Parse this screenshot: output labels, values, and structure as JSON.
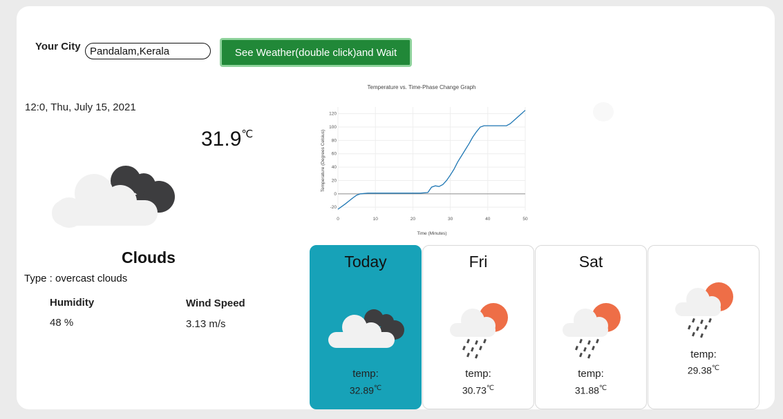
{
  "search": {
    "city_label": "Your City",
    "city_value": "Pandalam,Kerala",
    "button_label": "See Weather(double click)and Wait"
  },
  "current": {
    "datetime": "12:0, Thu, July 15, 2021",
    "temperature": "31.9",
    "unit": "℃",
    "condition": "Clouds",
    "type": "Type : overcast clouds",
    "humidity_label": "Humidity",
    "humidity_value": "48 %",
    "wind_label": "Wind Speed",
    "wind_value": "3.13 m/s",
    "icon": "broken-clouds-icon"
  },
  "chart_data": {
    "type": "line",
    "title": "Temperature vs. Time-Phase Change Graph",
    "xlabel": "Time (Minutes)",
    "ylabel": "Temperature (Degrees Celsius)",
    "xlim": [
      0,
      50
    ],
    "ylim": [
      -25,
      130
    ],
    "xticks": [
      0,
      10,
      20,
      30,
      40,
      50
    ],
    "yticks": [
      -20,
      0,
      20,
      40,
      60,
      80,
      100,
      120
    ],
    "series": [
      {
        "color": "#1f77b4",
        "x": [
          0,
          2,
          4,
          5,
          6,
          8,
          10,
          15,
          20,
          22,
          24,
          25,
          26,
          27,
          28,
          29,
          30,
          31,
          32,
          33,
          34,
          35,
          36,
          37,
          38,
          39,
          40,
          42,
          44,
          45,
          46,
          48,
          50
        ],
        "y": [
          -23,
          -15,
          -6,
          -2,
          0,
          1,
          1,
          1,
          1,
          1,
          2,
          10,
          12,
          11,
          14,
          20,
          28,
          37,
          48,
          57,
          66,
          75,
          85,
          93,
          100,
          102,
          102,
          102,
          102,
          102,
          105,
          115,
          125
        ]
      }
    ]
  },
  "forecast": [
    {
      "day": "Today",
      "temp_label": "temp:",
      "temp_value": "32.89",
      "unit": "℃",
      "icon": "broken-clouds-icon",
      "highlight": "#17a2b8"
    },
    {
      "day": "Fri",
      "temp_label": "temp:",
      "temp_value": "30.73",
      "unit": "℃",
      "icon": "rain-sun-icon"
    },
    {
      "day": "Sat",
      "temp_label": "temp:",
      "temp_value": "31.88",
      "unit": "℃",
      "icon": "rain-sun-icon"
    },
    {
      "day": "",
      "temp_label": "temp:",
      "temp_value": "29.38",
      "unit": "℃",
      "icon": "rain-sun-icon"
    }
  ]
}
